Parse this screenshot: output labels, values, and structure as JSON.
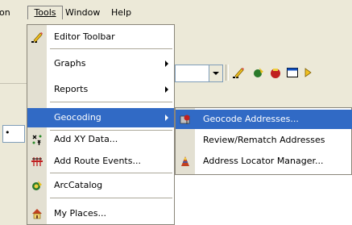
{
  "menubar": {
    "fragment": "on",
    "tools": "Tools",
    "window": "Window",
    "help": "Help"
  },
  "toolbar": {
    "left_fragment": "•"
  },
  "tools_menu": {
    "items": [
      {
        "label": "Editor Toolbar",
        "icon": "editor-pencil-icon",
        "submenu": false
      },
      {
        "label": "Graphs",
        "icon": "",
        "submenu": true
      },
      {
        "label": "Reports",
        "icon": "",
        "submenu": true
      },
      {
        "label": "Geocoding",
        "icon": "",
        "submenu": true,
        "selected": true
      },
      {
        "label": "Add XY Data...",
        "icon": "xy-data-icon",
        "submenu": false
      },
      {
        "label": "Add Route Events...",
        "icon": "route-events-icon",
        "submenu": false
      },
      {
        "label": "ArcCatalog",
        "icon": "arccatalog-icon",
        "submenu": false
      },
      {
        "label": "My Places...",
        "icon": "my-places-icon",
        "submenu": false
      }
    ]
  },
  "geocoding_submenu": {
    "items": [
      {
        "label": "Geocode Addresses...",
        "icon": "geocode-addresses-icon",
        "selected": true
      },
      {
        "label": "Review/Rematch Addresses",
        "icon": ""
      },
      {
        "label": "Address Locator Manager...",
        "icon": "address-locator-manager-icon"
      }
    ]
  },
  "colors": {
    "highlight": "#316ac5",
    "menu_bg": "#ffffff",
    "gutter": "#e3e0d2",
    "chrome": "#ece9d8"
  }
}
